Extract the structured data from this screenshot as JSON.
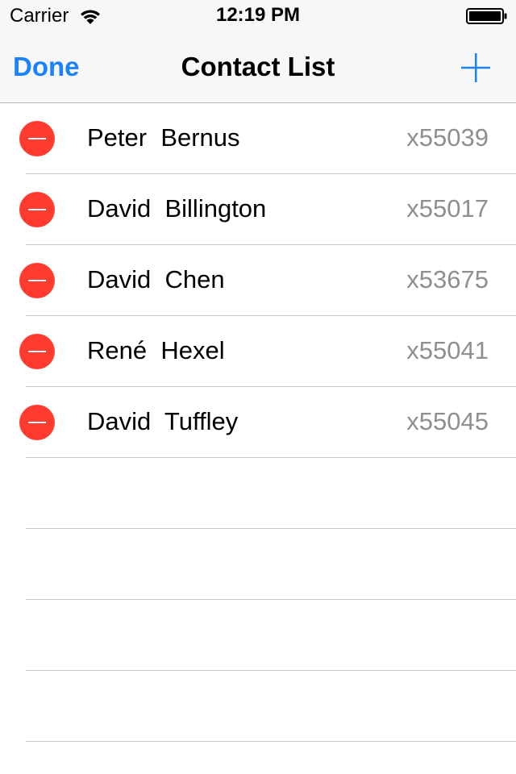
{
  "status_bar": {
    "carrier": "Carrier",
    "time": "12:19 PM",
    "icons": [
      "wifi-icon",
      "battery-icon"
    ]
  },
  "nav_bar": {
    "left_button": "Done",
    "title": "Contact List",
    "right_button_icon": "plus-icon"
  },
  "colors": {
    "accent": "#1a82fb",
    "delete": "#ff3b30",
    "secondary_text": "#8e8e93",
    "separator": "#c8c7cc"
  },
  "contacts": [
    {
      "name": "Peter  Bernus",
      "extension": "x55039"
    },
    {
      "name": "David  Billington",
      "extension": "x55017"
    },
    {
      "name": "David  Chen",
      "extension": "x53675"
    },
    {
      "name": "René  Hexel",
      "extension": "x55041"
    },
    {
      "name": "David  Tuffley",
      "extension": "x55045"
    },
    {
      "name": "",
      "extension": ""
    },
    {
      "name": "",
      "extension": ""
    },
    {
      "name": "",
      "extension": ""
    },
    {
      "name": "",
      "extension": ""
    }
  ],
  "editing": true
}
